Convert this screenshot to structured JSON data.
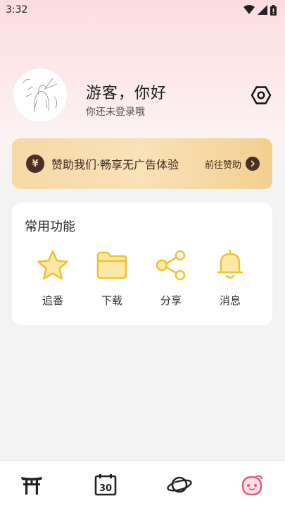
{
  "status_bar": {
    "time": "3:32"
  },
  "profile": {
    "greeting": "游客，你好",
    "subtitle": "你还未登录哦"
  },
  "sponsor": {
    "coin_symbol": "¥",
    "text": "赞助我们·畅享无广告体验",
    "link": "前往赞助"
  },
  "functions": {
    "title": "常用功能",
    "items": [
      {
        "label": "追番",
        "icon": "star-icon"
      },
      {
        "label": "下载",
        "icon": "folder-icon"
      },
      {
        "label": "分享",
        "icon": "share-icon"
      },
      {
        "label": "消息",
        "icon": "bell-icon"
      }
    ]
  },
  "bottom_nav": {
    "items": [
      {
        "icon": "torii-gate-icon"
      },
      {
        "icon": "calendar-icon",
        "text": "30"
      },
      {
        "icon": "planet-icon"
      },
      {
        "icon": "mascot-icon"
      }
    ]
  },
  "colors": {
    "accent": "#f5c54a",
    "sponsor_dark": "#4a2f27",
    "active_nav": "#e05a7a"
  }
}
